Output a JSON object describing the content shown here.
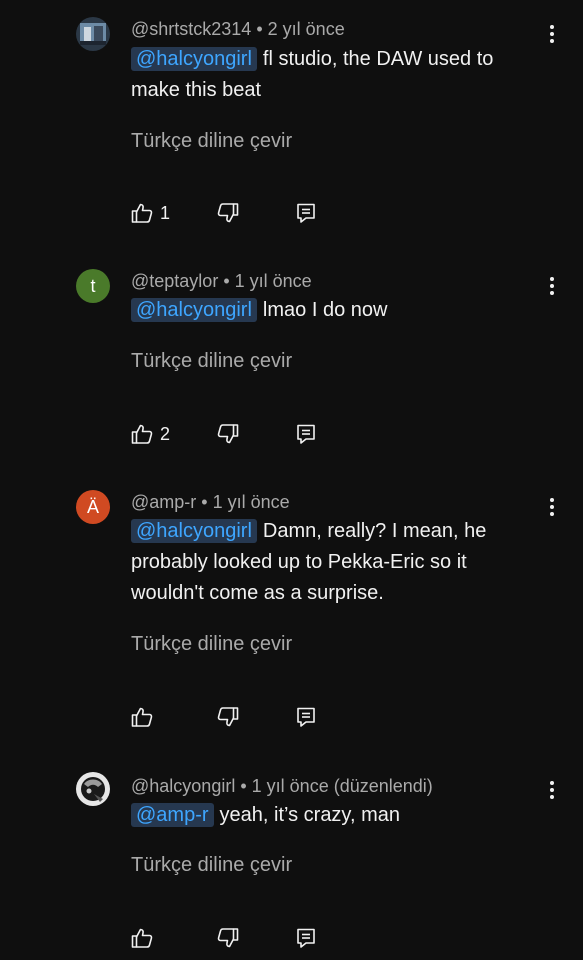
{
  "comments": [
    {
      "author": "@shrtstck2314",
      "time": "2 yıl önce",
      "edited": "",
      "mention": "@halcyongirl",
      "text": "fl studio, the DAW used to make this beat",
      "translate": "Türkçe diline çevir",
      "likes": "1",
      "avatar": {
        "type": "image",
        "colors": [
          "#6d8ba6",
          "#2b3846"
        ]
      }
    },
    {
      "author": "@teptaylor",
      "time": "1 yıl önce",
      "edited": "",
      "mention": "@halcyongirl",
      "text": "lmao I do now",
      "translate": "Türkçe diline çevir",
      "likes": "2",
      "avatar": {
        "type": "letter",
        "letter": "t",
        "color": "#4a7a2a"
      }
    },
    {
      "author": "@amp-r",
      "time": "1 yıl önce",
      "edited": "",
      "mention": "@halcyongirl",
      "text": "Damn, really? I mean, he probably looked up to Pekka-Eric so it wouldn't come as a surprise.",
      "translate": "Türkçe diline çevir",
      "likes": "",
      "avatar": {
        "type": "letter",
        "letter": "Ä",
        "color": "#d04a22"
      }
    },
    {
      "author": "@halcyongirl",
      "time": "1 yıl önce",
      "edited": "(düzenlendi)",
      "mention": "@amp-r",
      "text": "yeah, it’s crazy, man",
      "translate": "Türkçe diline çevir",
      "likes": "",
      "avatar": {
        "type": "image",
        "colors": [
          "#9a9a9a",
          "#1a1a1a"
        ]
      }
    }
  ],
  "icons": {
    "like": "thumbs-up-icon",
    "dislike": "thumbs-down-icon",
    "reply": "reply-icon",
    "more": "more-vertical-icon"
  },
  "colors": {
    "background": "#0f0f0f",
    "text": "#f1f1f1",
    "secondary_text": "#aaaaaa",
    "mention_text": "#3ea6ff",
    "mention_bg": "#263850"
  }
}
